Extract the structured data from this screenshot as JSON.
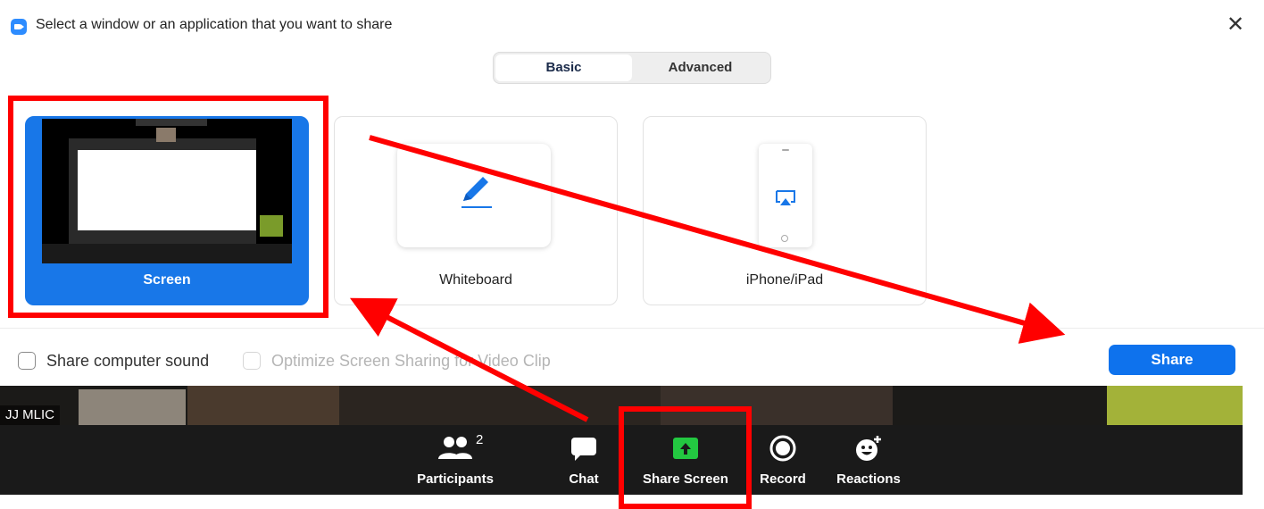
{
  "window": {
    "title": "Select a window or an application that you want to share",
    "logo_icon": "zoom-logo-icon",
    "close_glyph": "✕"
  },
  "tabs": [
    {
      "label": "Basic",
      "active": true
    },
    {
      "label": "Advanced",
      "active": false
    }
  ],
  "share_options": [
    {
      "label": "Screen",
      "selected": true,
      "icon": "screen-thumbnail"
    },
    {
      "label": "Whiteboard",
      "selected": false,
      "icon": "pencil-icon"
    },
    {
      "label": "iPhone/iPad",
      "selected": false,
      "icon": "airplay-icon"
    }
  ],
  "options": {
    "share_sound": {
      "label": "Share computer sound",
      "checked": false,
      "enabled": true
    },
    "optimize": {
      "label": "Optimize Screen Sharing for Video Clip",
      "checked": false,
      "enabled": false
    }
  },
  "share_button": {
    "label": "Share"
  },
  "video": {
    "participant_name": "JJ MLIC"
  },
  "toolbar": {
    "participants": {
      "label": "Participants",
      "count": "2",
      "icon": "participants-icon"
    },
    "chat": {
      "label": "Chat",
      "icon": "chat-icon"
    },
    "share_screen": {
      "label": "Share Screen",
      "icon": "share-screen-icon"
    },
    "record": {
      "label": "Record",
      "icon": "record-icon"
    },
    "reactions": {
      "label": "Reactions",
      "icon": "reactions-icon"
    }
  },
  "colors": {
    "accent_blue": "#0e72ed",
    "selected_tile": "#1877e8",
    "share_green": "#23c841",
    "annotation_red": "#ff0000",
    "toolbar_bg": "#1a1a1a"
  }
}
